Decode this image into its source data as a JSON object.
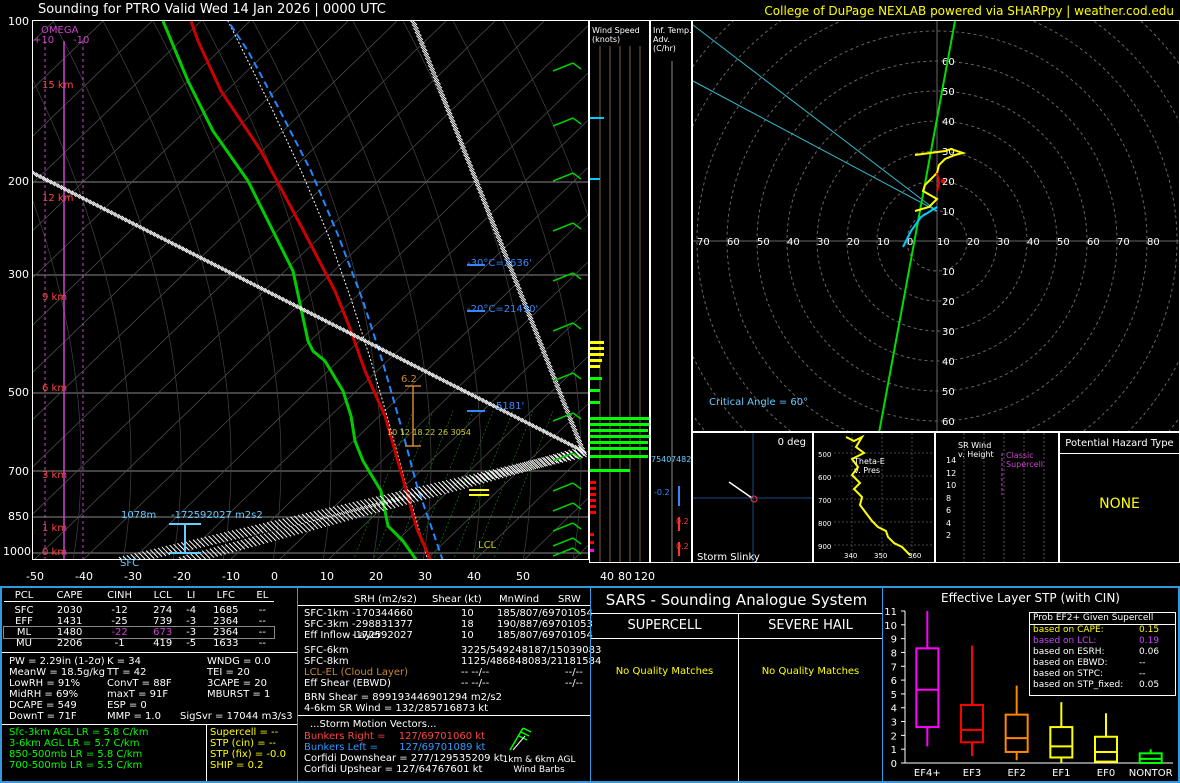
{
  "header": {
    "title": "Sounding for PTRO Valid  Wed 14 Jan 2026 | 0000 UTC",
    "credit": "College of DuPage NEXLAB powered via SHARPpy | weather.cod.edu"
  },
  "skewt": {
    "omega_label": "OMEGA",
    "omega_plus": "+10",
    "omega_minus": "-10",
    "pressure_labels": [
      "100",
      "200",
      "300",
      "500",
      "700",
      "850",
      "1000"
    ],
    "height_labels": [
      "15 km",
      "12 km",
      "9 km",
      "6 km",
      "3 km",
      "1 km",
      "0 km"
    ],
    "temp_labels": [
      "-50",
      "-40",
      "-30",
      "-20",
      "-10",
      "0",
      "10",
      "20",
      "30",
      "40",
      "50"
    ],
    "sfc_label": "SFC",
    "lcl_height": "1078m",
    "eff_inflow_label": "-172592027 m2s2",
    "minus30_label": "-30°C=2636'",
    "minus20_label": "-20°C=21410'",
    "freeze_label": "5181'",
    "dcape_label": "6.2",
    "lcl_label": "LCL",
    "sfc_temp": "77",
    "sfc_dew": "0",
    "ship_nums": "10  12  18 22 26 3054",
    "colors": {
      "temp": "#e00000",
      "dew": "#00cc00",
      "virt": "#cc3333",
      "wetbulb": "#00aaff",
      "parcel": "#ffffff",
      "omega": "#cc44cc"
    }
  },
  "wind_speed": {
    "title": "Wind Speed (knots)",
    "axis": [
      "40",
      "80",
      "120"
    ]
  },
  "temp_adv": {
    "title": "Inf. Temp. Adv. (C/hr)",
    "values": [
      "-0.2",
      "0.2",
      "0.2"
    ],
    "mid_label": "7540",
    "mid_label2": "7482"
  },
  "hodograph": {
    "rings": [
      "10",
      "20",
      "30",
      "40",
      "50",
      "60",
      "70",
      "80"
    ],
    "critical_angle": "Critical Angle = 60°",
    "y_labels": [
      "60",
      "50",
      "40",
      "30",
      "20",
      "10",
      "10",
      "20",
      "30",
      "40",
      "50",
      "60"
    ],
    "x_labels": [
      "70",
      "60",
      "50",
      "40",
      "30",
      "20",
      "10",
      "0",
      "10",
      "20",
      "30",
      "40",
      "50",
      "60",
      "70",
      "80"
    ]
  },
  "storm_slinky": {
    "title": "Storm Slinky",
    "angle": "0 deg"
  },
  "theta": {
    "title": "Theta-E v. Pres",
    "y": [
      "500",
      "600",
      "700",
      "800",
      "900"
    ],
    "x": [
      "340",
      "350",
      "360"
    ],
    "top": "500",
    "bottom": "1000"
  },
  "srwind": {
    "title": "SR Wind v. Height",
    "y": [
      "14",
      "12",
      "10",
      "8",
      "6",
      "4",
      "2"
    ],
    "label": "Classic Supercell"
  },
  "hazard": {
    "title": "Potential Hazard Type",
    "value": "NONE"
  },
  "parcel_table": {
    "headers": [
      "PCL",
      "CAPE",
      "CINH",
      "LCL",
      "LI",
      "LFC",
      "EL"
    ],
    "rows": [
      [
        "SFC",
        "2030",
        "-12",
        "274",
        "-4",
        "1685",
        "--"
      ],
      [
        "EFF",
        "1431",
        "-25",
        "739",
        "-3",
        "2364",
        "--"
      ],
      [
        "ML",
        "1480",
        "-22",
        "673",
        "-3",
        "2364",
        "--"
      ],
      [
        "MU",
        "2206",
        "-1",
        "419",
        "-5",
        "1633",
        "--"
      ]
    ]
  },
  "thermo": {
    "col1": [
      "PW = 2.29in (1-2σ)",
      "MeanW = 18.5g/kg",
      "LowRH = 91%",
      "MidRH = 69%",
      "DCAPE = 549",
      "DownT = 71F"
    ],
    "col2": [
      "K = 34",
      "TT = 42",
      "ConvT = 88F",
      "maxT = 91F",
      "ESP = 0",
      "MMP = 1.0"
    ],
    "col3": [
      "WNDG = 0.0",
      "TEI = 20",
      "3CAPE = 20",
      "MBURST = 1",
      "",
      ""
    ],
    "sigsvr": "SigSvr = 17044 m3/s3"
  },
  "lapse": [
    "Sfc-3km AGL LR = 5.8 C/km",
    "3-6km AGL LR = 5.7 C/km",
    "850-500mb LR = 5.8 C/km",
    "700-500mb LR = 5.5 C/km"
  ],
  "composites": [
    "Supercell = --",
    "STP (cin) = --",
    "STP (fix) = -0.0",
    "SHIP = 0.2"
  ],
  "kinematics": {
    "headers": [
      "SRH (m2/s2)",
      "Shear (kt)",
      "MnWind",
      "SRW"
    ],
    "rows": [
      [
        "SFC-1km",
        "-170344660",
        "10",
        "185/807/69701054"
      ],
      [
        "SFC-3km",
        "-298831377",
        "18",
        "190/887/69701053"
      ],
      [
        "Eff Inflow Layer",
        "-172592027",
        "10",
        "185/807/69701054"
      ],
      [
        "SFC-6km",
        "",
        "3225/549248187/15039083",
        ""
      ],
      [
        "SFC-8km",
        "",
        "1125/486848083/21181584",
        ""
      ],
      [
        "LCL-EL (Cloud Layer)",
        "",
        "--   --/--",
        "--/--"
      ],
      [
        "Eff Shear (EBWD)",
        "",
        "--   --/--",
        "--/--"
      ]
    ],
    "brn": "BRN Shear = 899193446901294 m2/s2",
    "sr46": "4-6km SR Wind = 132/285716873 kt",
    "storm_title": "...Storm Motion Vectors...",
    "bunkers_right": "Bunkers Right =",
    "bunkers_right_val": "127/69701060 kt",
    "bunkers_left": "Bunkers Left =",
    "bunkers_left_val": "127/69701089 kt",
    "corfidi_down": "Corfidi Downshear = 277/129535209 kt",
    "corfidi_up": "Corfidi Upshear = 127/64767601 kt",
    "barb_label": "1km & 6km AGL Wind Barbs"
  },
  "sars": {
    "title": "SARS - Sounding Analogue System",
    "supercell": "SUPERCELL",
    "hail": "SEVERE HAIL",
    "nomatch": "No Quality Matches"
  },
  "stp": {
    "title": "Effective Layer STP (with CIN)",
    "legend_title": "Prob EF2+ Given Supercell",
    "legend": [
      {
        "k": "based on CAPE:",
        "v": "0.15",
        "color": "#ffff00"
      },
      {
        "k": "based on LCL:",
        "v": "0.19",
        "color": "#cc44ff"
      },
      {
        "k": "based on ESRH:",
        "v": "0.06",
        "color": "#ffffff"
      },
      {
        "k": "based on EBWD:",
        "v": "--",
        "color": "#ffffff"
      },
      {
        "k": "based on STPC:",
        "v": "--",
        "color": "#ffffff"
      },
      {
        "k": "based on STP_fixed:",
        "v": "0.05",
        "color": "#ffffff"
      }
    ],
    "y_ticks": [
      "11",
      "10",
      "9",
      "8",
      "7",
      "6",
      "5",
      "4",
      "3",
      "2",
      "1",
      "0"
    ],
    "categories": [
      "EF4+",
      "EF3",
      "EF2",
      "EF1",
      "EF0",
      "NONTOR"
    ]
  },
  "chart_data": {
    "type": "box",
    "title": "Effective Layer STP (with CIN)",
    "categories": [
      "EF4+",
      "EF3",
      "EF2",
      "EF1",
      "EF0",
      "NONTOR"
    ],
    "ylim": [
      0,
      11
    ],
    "boxes": [
      {
        "min": 1.2,
        "q1": 2.6,
        "median": 5.3,
        "q3": 8.3,
        "max": 11,
        "color": "#ff00ff"
      },
      {
        "min": 0.5,
        "q1": 1.5,
        "median": 2.4,
        "q3": 4.2,
        "max": 8.5,
        "color": "#ff0000"
      },
      {
        "min": 0.2,
        "q1": 0.8,
        "median": 1.8,
        "q3": 3.5,
        "max": 5.6,
        "color": "#ff8800"
      },
      {
        "min": 0.0,
        "q1": 0.4,
        "median": 1.2,
        "q3": 2.6,
        "max": 4.4,
        "color": "#ffff00"
      },
      {
        "min": 0.0,
        "q1": 0.1,
        "median": 0.8,
        "q3": 1.9,
        "max": 3.6,
        "color": "#ffff00"
      },
      {
        "min": 0.0,
        "q1": 0.0,
        "median": 0.3,
        "q3": 0.7,
        "max": 1.0,
        "color": "#00ff00"
      }
    ]
  }
}
